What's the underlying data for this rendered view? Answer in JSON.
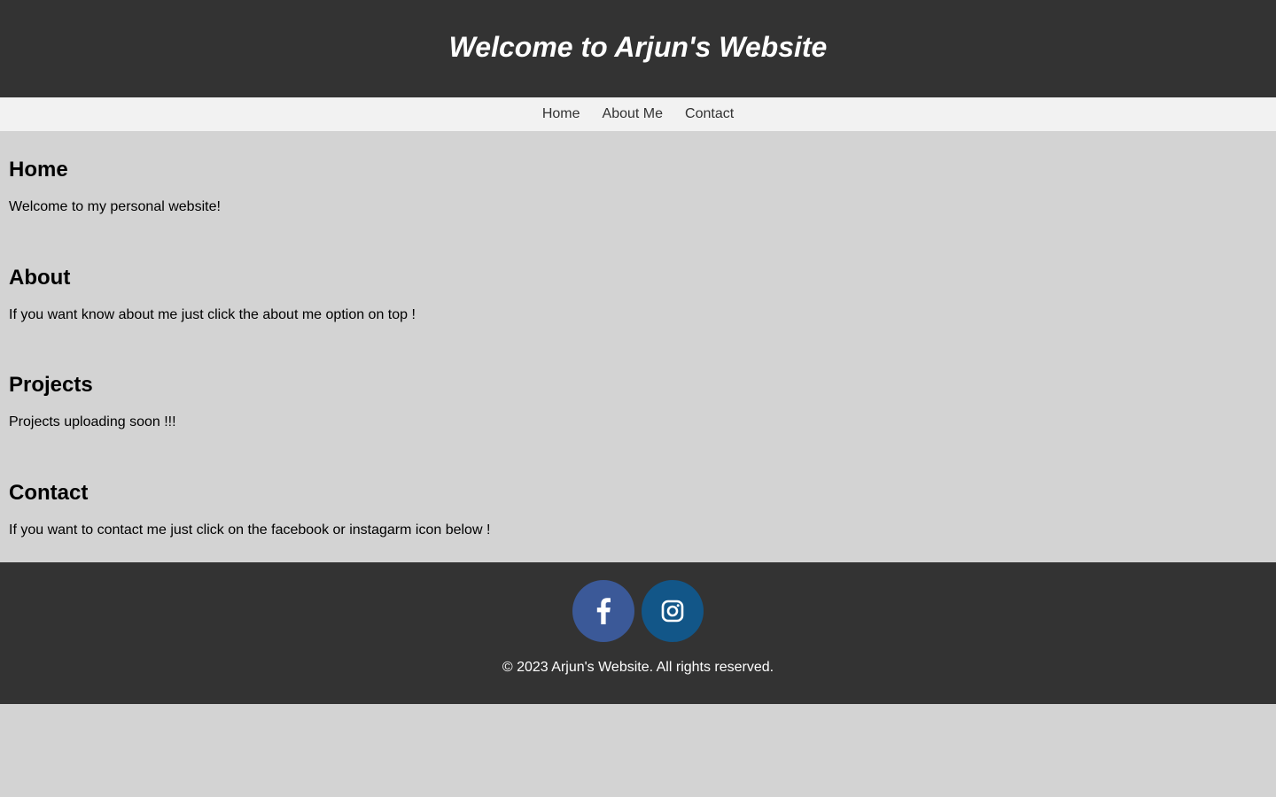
{
  "header": {
    "title": "Welcome to Arjun's Website"
  },
  "nav": {
    "items": [
      {
        "label": "Home"
      },
      {
        "label": "About Me"
      },
      {
        "label": "Contact"
      }
    ]
  },
  "sections": [
    {
      "heading": "Home",
      "text": "Welcome to my personal website!"
    },
    {
      "heading": "About",
      "text": "If you want know about me just click the about me option on top !"
    },
    {
      "heading": "Projects",
      "text": "Projects uploading soon !!!"
    },
    {
      "heading": "Contact",
      "text": "If you want to contact me just click on the facebook or instagarm icon below !"
    }
  ],
  "footer": {
    "social": [
      {
        "icon": "facebook-icon",
        "color": "#3b5998"
      },
      {
        "icon": "instagram-icon",
        "color": "#125688"
      }
    ],
    "copyright": "© 2023 Arjun's Website. All rights reserved."
  },
  "colors": {
    "header_bg": "#333333",
    "nav_bg": "#f2f2f2",
    "page_bg": "#d3d3d3",
    "footer_bg": "#333333"
  }
}
